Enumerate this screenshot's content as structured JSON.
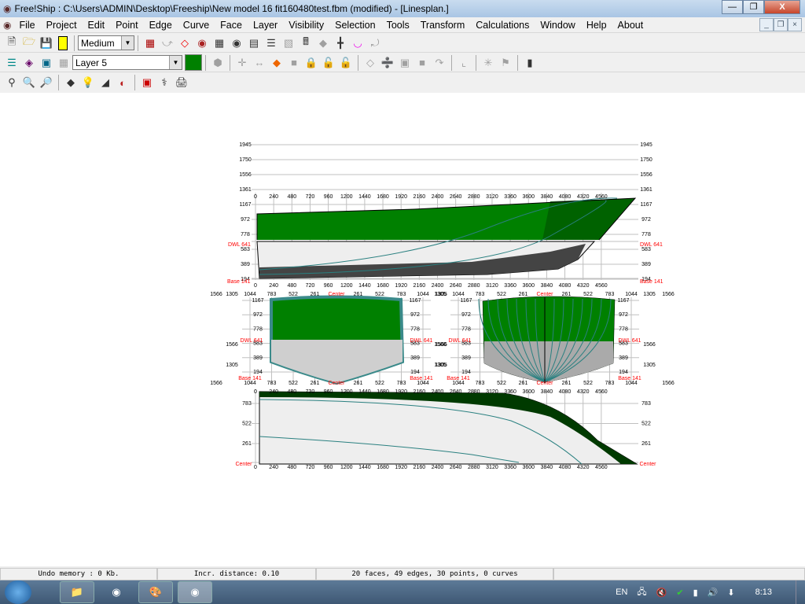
{
  "window": {
    "app": "Free!Ship",
    "title": "Free!Ship  : C:\\Users\\ADMIN\\Desktop\\Freeship\\New model 16 fit160480test.fbm (modified) - [Linesplan.]",
    "minimize": "—",
    "restore": "❐",
    "close": "X"
  },
  "menu": [
    "File",
    "Project",
    "Edit",
    "Point",
    "Edge",
    "Curve",
    "Face",
    "Layer",
    "Visibility",
    "Selection",
    "Tools",
    "Transform",
    "Calculations",
    "Window",
    "Help",
    "About"
  ],
  "mdi": {
    "minimize": "_",
    "restore": "❐",
    "close": "×"
  },
  "toolbar1": {
    "precision": "Medium"
  },
  "toolbar2": {
    "layer": "Layer 5",
    "layer_color": "#008000"
  },
  "drawing": {
    "heights": [
      "1945",
      "1750",
      "1556",
      "1361",
      "1167",
      "972",
      "778",
      "583",
      "389",
      "194"
    ],
    "stations": [
      "0",
      "240",
      "480",
      "720",
      "960",
      "1200",
      "1440",
      "1680",
      "1920",
      "2160",
      "2400",
      "2640",
      "2880",
      "3120",
      "3360",
      "3600",
      "3840",
      "4080",
      "4320",
      "4560"
    ],
    "half_breadths": [
      "1044",
      "783",
      "522",
      "261",
      "Center",
      "261",
      "522",
      "783",
      "1044"
    ],
    "plan_breadths": [
      "783",
      "522",
      "261"
    ],
    "dwl_label": "DWL 641",
    "base_label": "Base 141",
    "center_label": "Center",
    "outer_labels": [
      "1566",
      "1305"
    ],
    "hull_color": "#008000",
    "label_color": "#ff0000"
  },
  "status": {
    "undo": "Undo memory : 0 Kb.",
    "incr": "Incr. distance: 0.10",
    "counts": "20 faces, 49 edges, 30 points, 0 curves"
  },
  "taskbar": {
    "lang": "EN",
    "time": "8:13"
  }
}
